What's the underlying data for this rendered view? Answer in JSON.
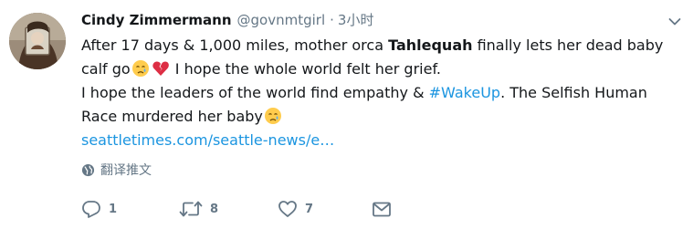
{
  "tweet": {
    "author_name": "Cindy Zimmermann",
    "author_handle": "@govnmtgirl",
    "separator": "·",
    "time": "3小时",
    "body": {
      "l1_a": "After 17 days & 1,000 miles, mother orca ",
      "l1_b": "Tahlequah",
      "l1_c": " finally lets her dead baby",
      "l2_a": "calf go",
      "l2_b": " I hope the whole world felt her grief.",
      "l3_a": "I hope the leaders of the world find empathy & ",
      "l3_hashtag": "#WakeUp",
      "l3_b": ". The Selfish Human",
      "l4_a": "Race murdered her baby",
      "link": "seattletimes.com/seattle-news/e…"
    },
    "emojis": [
      "crying-face-emoji",
      "broken-heart-emoji",
      "crying-face-emoji"
    ],
    "translate_label": "翻译推文",
    "actions": {
      "reply_count": "1",
      "retweet_count": "8",
      "like_count": "7"
    }
  },
  "colors": {
    "text": "#14171a",
    "secondary": "#657786",
    "link": "#1b95e0"
  }
}
